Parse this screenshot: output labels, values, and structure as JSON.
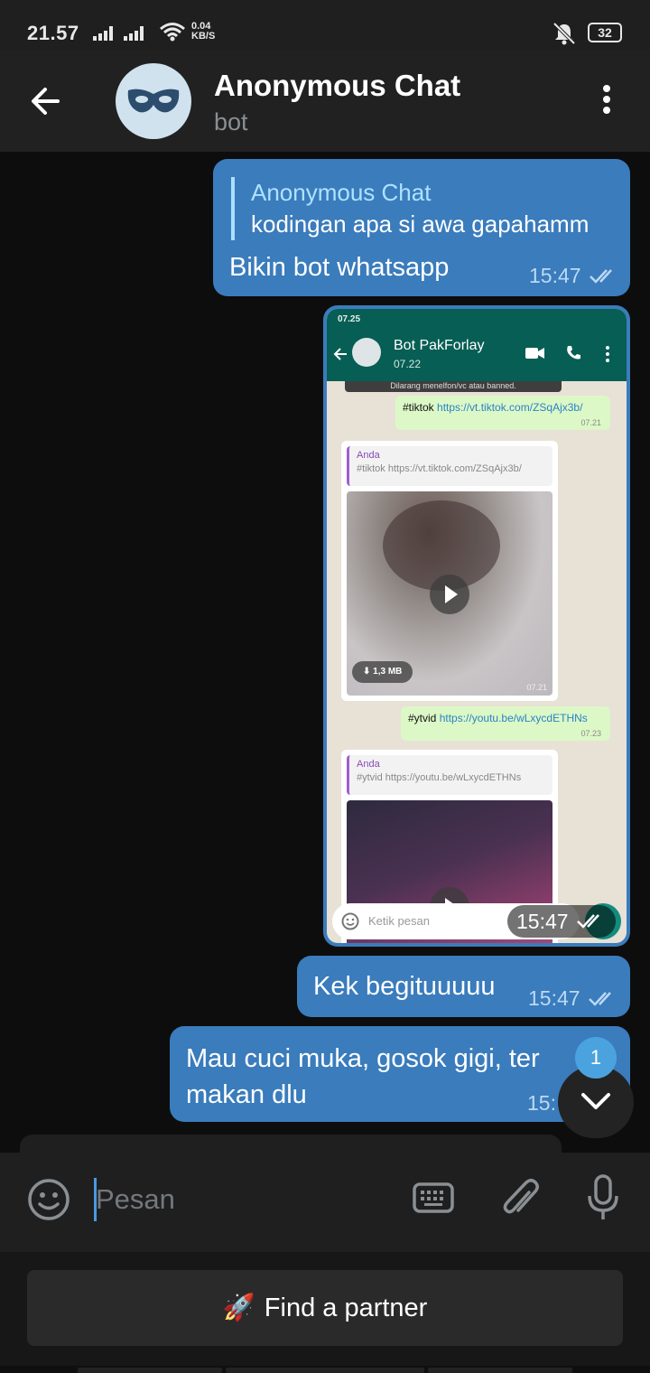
{
  "status_bar": {
    "time": "21.57",
    "network_speed": "0.04",
    "network_unit": "KB/S",
    "battery": "32",
    "icons": [
      "signal-icon",
      "signal-icon",
      "wifi-icon",
      "bell-off-icon",
      "battery-icon"
    ]
  },
  "header": {
    "title": "Anonymous Chat",
    "subtitle": "bot",
    "avatar_icon": "mask-icon",
    "avatar_bg": "#cfe2ee"
  },
  "messages": [
    {
      "reply_to_name": "Anonymous Chat",
      "reply_to_text": "kodingan apa si awa gapahamm",
      "text": "Bikin bot whatsapp",
      "time": "15:47"
    },
    {
      "type": "photo",
      "time": "15:47",
      "screenshot": {
        "status_time": "07.25",
        "chat_name": "Bot PakForlay",
        "chat_sub": "07.22",
        "banner": "Dilarang menelfon/vc atau banned.",
        "out1_tag": "#tiktok",
        "out1_link": "https://vt.tiktok.com/ZSqAjx3b/",
        "out1_time": "07.21",
        "in1_quote_name": "Anda",
        "in1_quote_text": "#tiktok https://vt.tiktok.com/ZSqAjx3b/",
        "in1_size": "1,3 MB",
        "in1_time": "07.21",
        "out2_tag": "#ytvid",
        "out2_link": "https://youtu.be/wLxycdETHNs",
        "out2_time": "07.23",
        "in2_quote_name": "Anda",
        "in2_quote_text": "#ytvid https://youtu.be/wLxycdETHNs",
        "input_placeholder": "Ketik pesan"
      }
    },
    {
      "text": "Kek begituuuuu",
      "time": "15:47"
    },
    {
      "text_line1": "Mau cuci muka, gosok gigi, ter",
      "text_line2": "makan dlu",
      "time": "15:"
    }
  ],
  "scroll_fab": {
    "badge": "1"
  },
  "composer": {
    "placeholder": "Pesan"
  },
  "bot_keyboard": {
    "button_emoji": "🚀",
    "button_label": "Find a partner"
  },
  "colors": {
    "outgoing_bubble": "#3a7cbc",
    "header_bg": "#212121",
    "chat_bg": "#0d0d0d",
    "accent": "#4aa3df"
  }
}
